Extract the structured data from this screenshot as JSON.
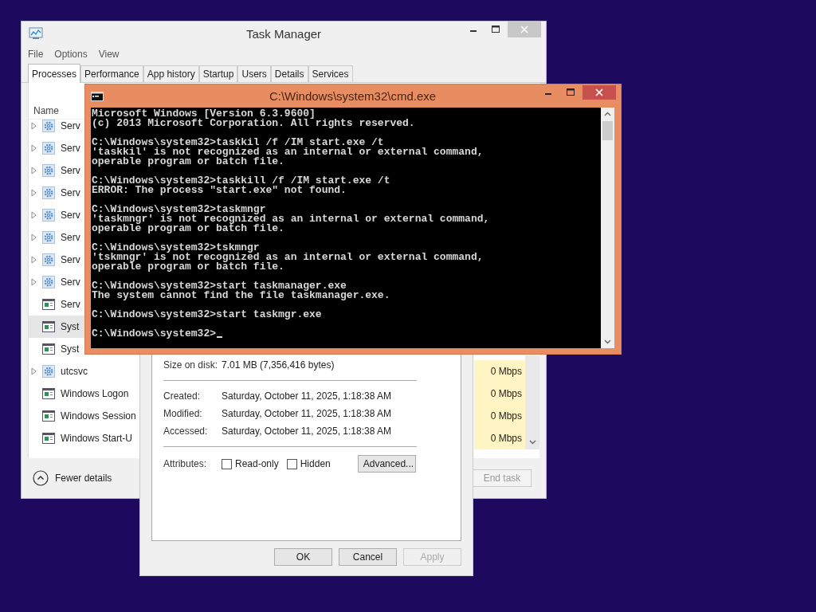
{
  "task_manager": {
    "title": "Task Manager",
    "menu": [
      "File",
      "Options",
      "View"
    ],
    "tabs": [
      {
        "label": "Processes",
        "selected": true
      },
      {
        "label": "Performance",
        "selected": false
      },
      {
        "label": "App history",
        "selected": false
      },
      {
        "label": "Startup",
        "selected": false
      },
      {
        "label": "Users",
        "selected": false
      },
      {
        "label": "Details",
        "selected": false
      },
      {
        "label": "Services",
        "selected": false
      }
    ],
    "column_header": "Name",
    "rows": [
      {
        "name": "Serv",
        "kind": "service",
        "expandable": true,
        "selected": false
      },
      {
        "name": "Serv",
        "kind": "service",
        "expandable": true,
        "selected": false
      },
      {
        "name": "Serv",
        "kind": "service",
        "expandable": true,
        "selected": false
      },
      {
        "name": "Serv",
        "kind": "service",
        "expandable": true,
        "selected": false
      },
      {
        "name": "Serv",
        "kind": "service",
        "expandable": true,
        "selected": false
      },
      {
        "name": "Serv",
        "kind": "service",
        "expandable": true,
        "selected": false
      },
      {
        "name": "Serv",
        "kind": "service",
        "expandable": true,
        "selected": false
      },
      {
        "name": "Serv",
        "kind": "service",
        "expandable": true,
        "selected": false
      },
      {
        "name": "Serv",
        "kind": "app",
        "expandable": false,
        "selected": false
      },
      {
        "name": "Syst",
        "kind": "app",
        "expandable": false,
        "selected": true
      },
      {
        "name": "Syst",
        "kind": "app",
        "expandable": false,
        "selected": false
      },
      {
        "name": "utcsvc",
        "kind": "service",
        "expandable": true,
        "selected": false,
        "network": "0 Mbps"
      },
      {
        "name": "Windows Logon",
        "kind": "app",
        "expandable": false,
        "selected": false,
        "network": "0 Mbps"
      },
      {
        "name": "Windows Session",
        "kind": "app",
        "expandable": false,
        "selected": false,
        "network": "0 Mbps"
      },
      {
        "name": "Windows Start-U",
        "kind": "app",
        "expandable": false,
        "selected": false,
        "network": "0 Mbps"
      }
    ],
    "details_link": "Fewer details",
    "end_task": {
      "label": "End task",
      "disabled": true
    }
  },
  "properties_dialog": {
    "size": {
      "label": "Size on disk:",
      "value": "7.01 MB (7,356,416 bytes)"
    },
    "dates": [
      {
        "label": "Created:",
        "value": "Saturday, October 11, 2025, 1:18:38 AM"
      },
      {
        "label": "Modified:",
        "value": "Saturday, October 11, 2025, 1:18:38 AM"
      },
      {
        "label": "Accessed:",
        "value": "Saturday, October 11, 2025, 1:18:38 AM"
      }
    ],
    "attributes": {
      "label": "Attributes:",
      "options": [
        {
          "label": "Read-only",
          "checked": false
        },
        {
          "label": "Hidden",
          "checked": false
        }
      ],
      "advanced_button": "Advanced..."
    },
    "buttons": [
      {
        "label": "OK",
        "disabled": false
      },
      {
        "label": "Cancel",
        "disabled": false
      },
      {
        "label": "Apply",
        "disabled": true
      }
    ]
  },
  "cmd": {
    "title": "C:\\Windows\\system32\\cmd.exe",
    "blocks": [
      [
        "Microsoft Windows [Version 6.3.9600]",
        "(c) 2013 Microsoft Corporation. All rights reserved."
      ],
      [
        "C:\\Windows\\system32>taskkil /f /IM start.exe /t",
        "'taskkil' is not recognized as an internal or external command,",
        "operable program or batch file."
      ],
      [
        "C:\\Windows\\system32>taskkill /f /IM start.exe /t",
        "ERROR: The process \"start.exe\" not found."
      ],
      [
        "C:\\Windows\\system32>taskmngr",
        "'taskmngr' is not recognized as an internal or external command,",
        "operable program or batch file."
      ],
      [
        "C:\\Windows\\system32>tskmngr",
        "'tskmngr' is not recognized as an internal or external command,",
        "operable program or batch file."
      ],
      [
        "C:\\Windows\\system32>start taskmanager.exe",
        "The system cannot find the file taskmanager.exe."
      ],
      [
        "C:\\Windows\\system32>start taskmgr.exe"
      ],
      [
        "C:\\Windows\\system32>"
      ]
    ],
    "cursor": true
  }
}
